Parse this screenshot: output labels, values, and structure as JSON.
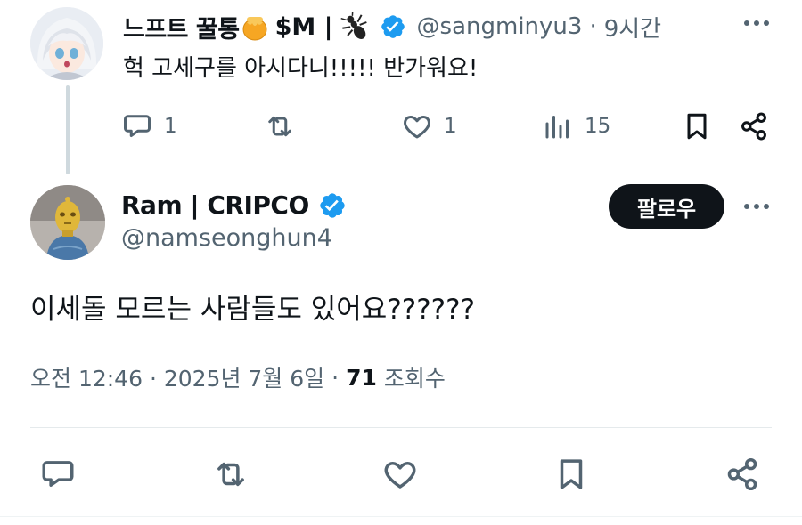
{
  "reply": {
    "display_name": "느프트 꿀통",
    "display_name_suffix": "$M |",
    "honey_emoji_icon": "honey-pot-icon",
    "bug_emoji_icon": "ant-icon",
    "handle": "@sangminyu3",
    "time": "9시간",
    "dot": "·",
    "text": "헉 고세구를 아시다니!!!!! 반가워요!",
    "replies": "1",
    "likes": "1",
    "views": "15"
  },
  "main": {
    "display_name": "Ram | CRIPCO",
    "handle": "@namseonghun4",
    "follow_label": "팔로우",
    "text": "이세돌 모르는 사람들도 있어요??????",
    "timestamp": "오전 12:46 · 2025년 7월 6일",
    "dot": "·",
    "views_count": "71",
    "views_label": "조회수"
  },
  "colors": {
    "verified": "#1d9bf0",
    "secondary_text": "#536471",
    "primary_text": "#0f1419",
    "follow_bg": "#0f1419"
  }
}
